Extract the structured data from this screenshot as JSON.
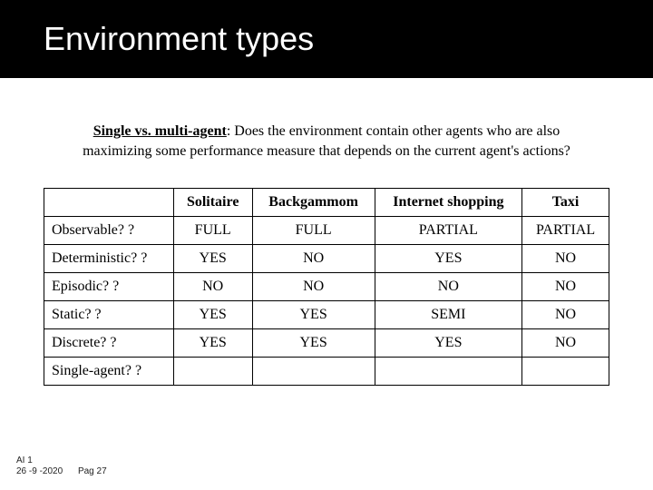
{
  "title": "Environment types",
  "description": {
    "lead_bold": "Single vs. multi-agent",
    "lead_rest": ": Does the environment contain other agents who are also maximizing some performance measure that depends on the current agent's actions?"
  },
  "table": {
    "headers": [
      "Solitaire",
      "Backgammom",
      "Internet shopping",
      "Taxi"
    ],
    "rows": [
      {
        "label": "Observable? ?",
        "cells": [
          "FULL",
          "FULL",
          "PARTIAL",
          "PARTIAL"
        ]
      },
      {
        "label": "Deterministic? ?",
        "cells": [
          "YES",
          "NO",
          "YES",
          "NO"
        ]
      },
      {
        "label": "Episodic? ?",
        "cells": [
          "NO",
          "NO",
          "NO",
          "NO"
        ]
      },
      {
        "label": "Static? ?",
        "cells": [
          "YES",
          "YES",
          "SEMI",
          "NO"
        ]
      },
      {
        "label": "Discrete? ?",
        "cells": [
          "YES",
          "YES",
          "YES",
          "NO"
        ]
      },
      {
        "label": "Single-agent? ?",
        "cells": [
          "",
          "",
          "",
          ""
        ]
      }
    ]
  },
  "footer": {
    "course": "AI 1",
    "date": "26 -9 -2020",
    "page": "Pag 27"
  },
  "chart_data": {
    "type": "table",
    "columns": [
      "",
      "Solitaire",
      "Backgammom",
      "Internet shopping",
      "Taxi"
    ],
    "rows": [
      [
        "Observable? ?",
        "FULL",
        "FULL",
        "PARTIAL",
        "PARTIAL"
      ],
      [
        "Deterministic? ?",
        "YES",
        "NO",
        "YES",
        "NO"
      ],
      [
        "Episodic? ?",
        "NO",
        "NO",
        "NO",
        "NO"
      ],
      [
        "Static? ?",
        "YES",
        "YES",
        "SEMI",
        "NO"
      ],
      [
        "Discrete? ?",
        "YES",
        "YES",
        "YES",
        "NO"
      ],
      [
        "Single-agent? ?",
        "",
        "",
        "",
        ""
      ]
    ],
    "title": "Environment types"
  }
}
